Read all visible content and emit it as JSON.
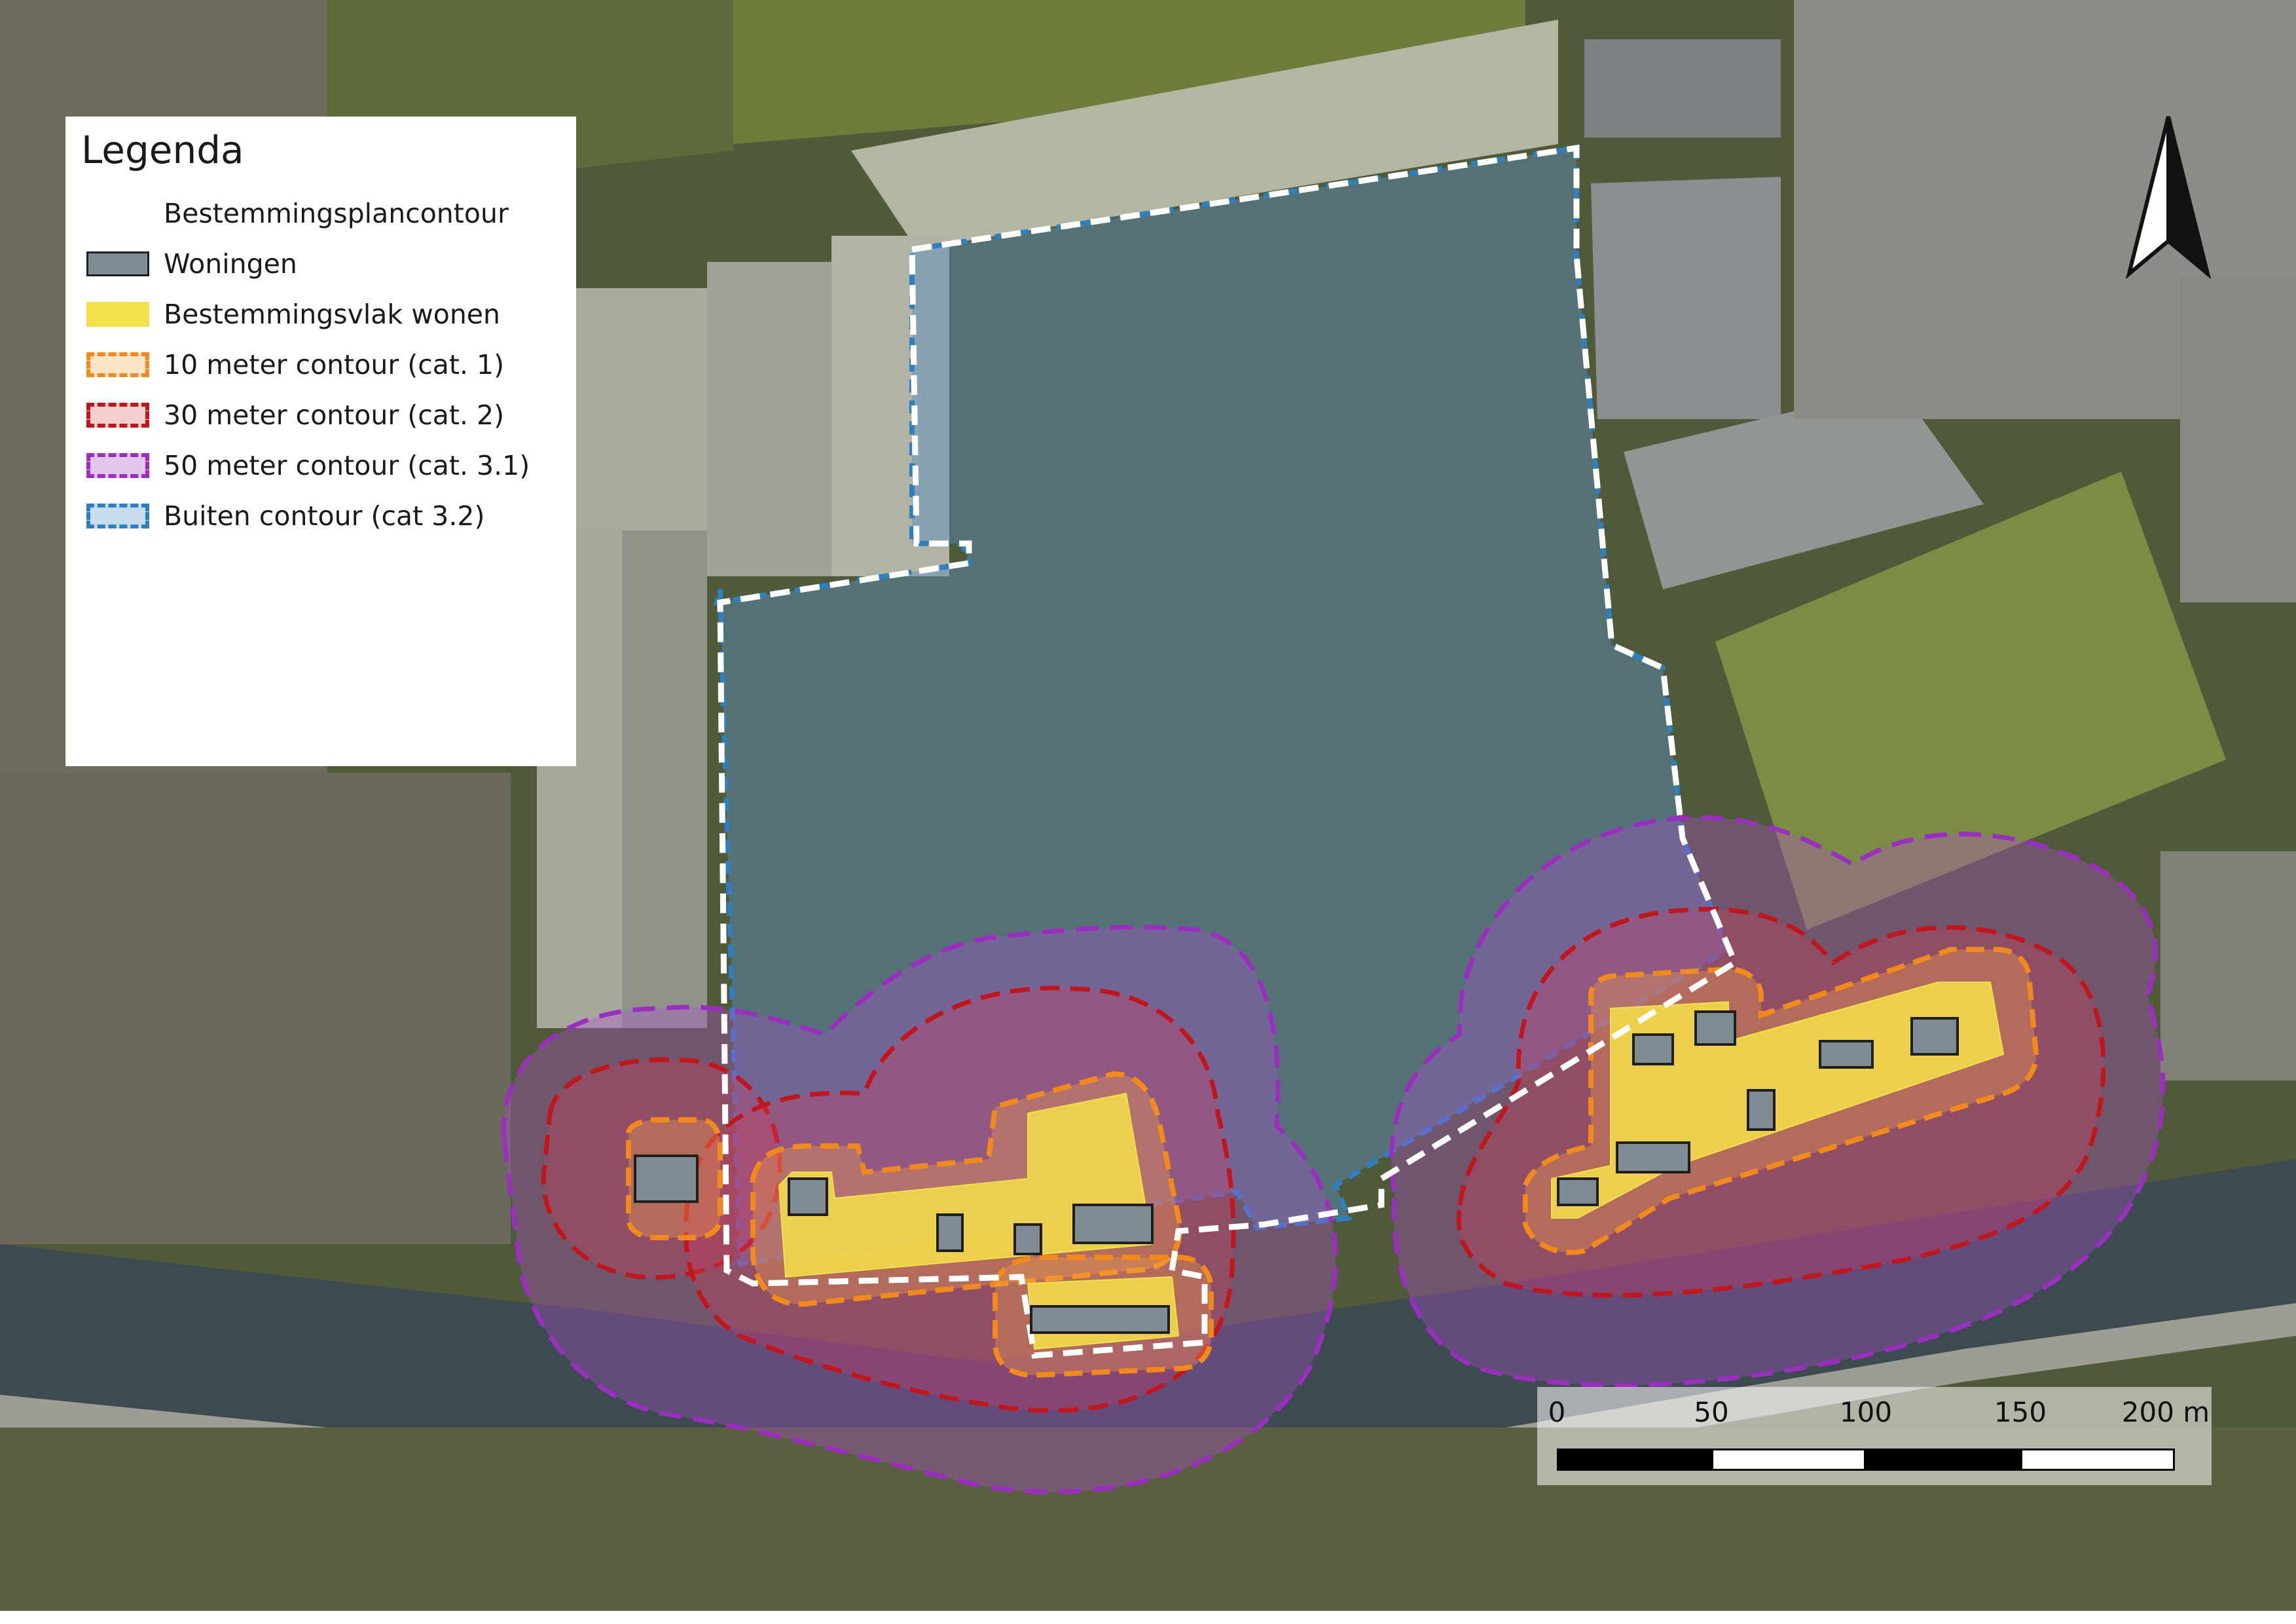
{
  "legend": {
    "title": "Legenda",
    "items": [
      {
        "label": "Bestemmingsplancontour",
        "icon": "white-dashed-line",
        "fill": "none",
        "stroke": "#ffffff"
      },
      {
        "label": "Woningen",
        "icon": "grey-building-swatch",
        "fill": "#7f8c93",
        "stroke": "#1f1f1f"
      },
      {
        "label": "Bestemmingsvlak wonen",
        "icon": "yellow-zone-swatch",
        "fill": "#f4e04a",
        "stroke": "#f4e04a"
      },
      {
        "label": "10 meter contour (cat. 1)",
        "icon": "orange-contour-swatch",
        "fill": "#fde3c8",
        "stroke": "#f08a1c"
      },
      {
        "label": "30 meter contour (cat. 2)",
        "icon": "red-contour-swatch",
        "fill": "#f3cfd0",
        "stroke": "#c0171d"
      },
      {
        "label": "50 meter contour (cat. 3.1)",
        "icon": "purple-contour-swatch",
        "fill": "#e3c6ee",
        "stroke": "#9a2fbf"
      },
      {
        "label": "Buiten contour (cat 3.2)",
        "icon": "blue-contour-swatch",
        "fill": "#c8dcec",
        "stroke": "#2f7fbf"
      }
    ]
  },
  "scalebar": {
    "ticks": [
      "0",
      "50",
      "100",
      "150",
      "200 m"
    ]
  },
  "north_arrow": {
    "icon": "north-arrow-icon"
  },
  "colors": {
    "plan_contour": "#ffffff",
    "woningen": "#7f8c93",
    "wonen_vlak": "#f4e04a",
    "contour_10m": "#f08a1c",
    "contour_30m": "#c0171d",
    "contour_50m": "#9a2fbf",
    "contour_buiten": "#2f7fbf"
  }
}
